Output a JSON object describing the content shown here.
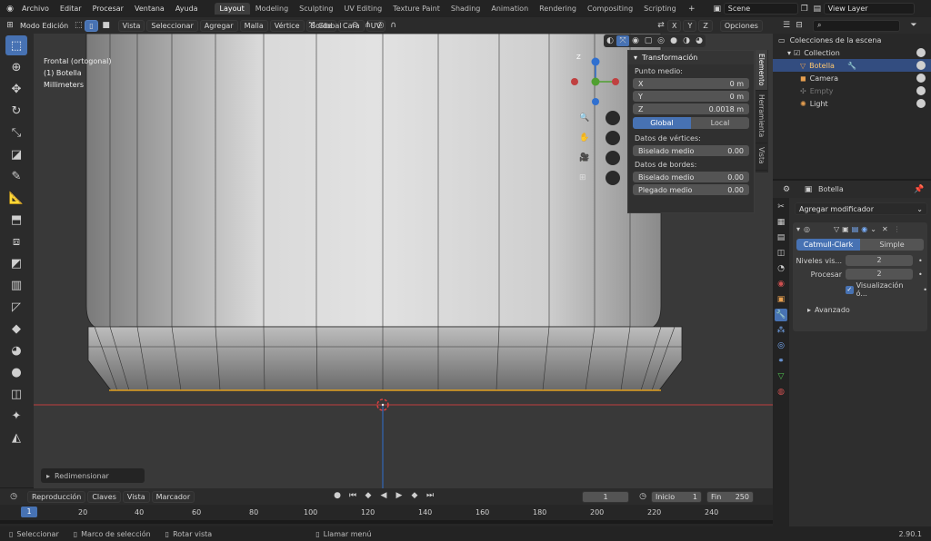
{
  "topbar": {
    "menus": [
      "Archivo",
      "Editar",
      "Procesar",
      "Ventana",
      "Ayuda"
    ],
    "workspaces": [
      "Layout",
      "Modeling",
      "Sculpting",
      "UV Editing",
      "Texture Paint",
      "Shading",
      "Animation",
      "Rendering",
      "Compositing",
      "Scripting"
    ],
    "active_workspace": "Layout",
    "scene": "Scene",
    "view_layer": "View Layer"
  },
  "header": {
    "mode": "Modo Edición",
    "menus": [
      "Vista",
      "Seleccionar",
      "Agregar",
      "Malla",
      "Vértice",
      "Borde",
      "Cara",
      "UV"
    ],
    "orientation": "Global",
    "options": "Opciones"
  },
  "viewport": {
    "view_label": "Frontal (ortogonal)",
    "object_label": "(1) Botella",
    "units_label": "Millimeters",
    "gizmo_x": "X",
    "gizmo_y": "Y",
    "gizmo_z": "Z",
    "last_op": "Redimensionar"
  },
  "npanel": {
    "title": "Transformación",
    "median_label": "Punto medio:",
    "coords": [
      {
        "axis": "X",
        "value": "0 m"
      },
      {
        "axis": "Y",
        "value": "0 m"
      },
      {
        "axis": "Z",
        "value": "0.0018 m"
      }
    ],
    "space_global": "Global",
    "space_local": "Local",
    "vertex_data": "Datos de vértices:",
    "bevel_weight": "Biselado medio",
    "bevel_weight_value": "0.00",
    "edge_data": "Datos de bordes:",
    "edge_bevel": "Biselado medio",
    "edge_bevel_value": "0.00",
    "crease": "Plegado medio",
    "crease_value": "0.00",
    "tabs": [
      "Elemento",
      "Herramienta",
      "Vista"
    ]
  },
  "outliner": {
    "root": "Colecciones de la escena",
    "items": [
      {
        "label": "Collection",
        "type": "collection"
      },
      {
        "label": "Botella",
        "type": "mesh"
      },
      {
        "label": "Camera",
        "type": "camera"
      },
      {
        "label": "Empty",
        "type": "empty"
      },
      {
        "label": "Light",
        "type": "light"
      }
    ]
  },
  "properties": {
    "object_name": "Botella",
    "add_modifier": "Agregar modificador",
    "mode_catmull": "Catmull-Clark",
    "mode_simple": "Simple",
    "levels_label": "Niveles vis...",
    "levels_value": "2",
    "render_label": "Procesar",
    "render_value": "2",
    "optimal_label": "Visualización ó...",
    "advanced": "Avanzado"
  },
  "timeline": {
    "playback": "Reproducción",
    "keys": "Claves",
    "view": "Vista",
    "marker": "Marcador",
    "current_frame": "1",
    "start_label": "Inicio",
    "start": "1",
    "end_label": "Fin",
    "end": "250",
    "ticks": [
      "1",
      "20",
      "40",
      "60",
      "80",
      "100",
      "120",
      "140",
      "160",
      "180",
      "200",
      "220",
      "240"
    ]
  },
  "statusbar": {
    "select": "Seleccionar",
    "box_select": "Marco de selección",
    "rotate": "Rotar vista",
    "menu": "Llamar menú",
    "version": "2.90.1"
  },
  "colors": {
    "accent": "#4772b3",
    "selected_edge": "#e0a020",
    "x_axis": "#c04040",
    "y_axis": "#50a030",
    "z_axis": "#3070d0"
  }
}
